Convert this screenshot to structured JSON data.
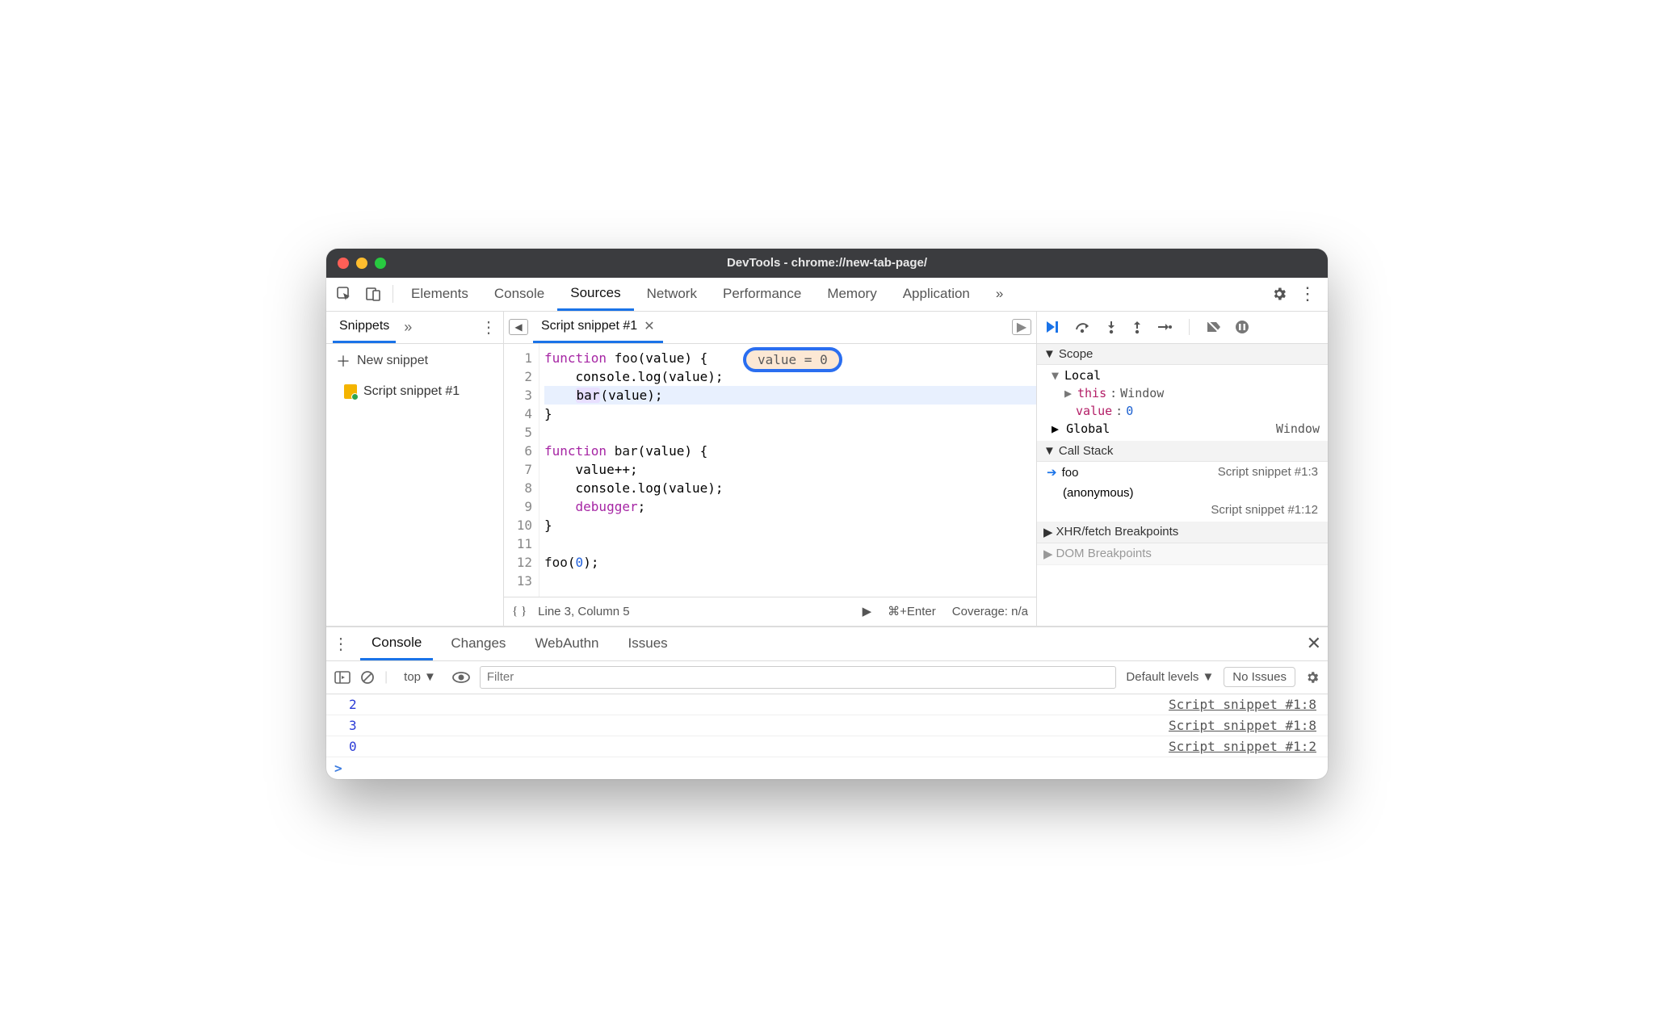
{
  "window": {
    "title": "DevTools - chrome://new-tab-page/"
  },
  "tabs": {
    "items": [
      "Elements",
      "Console",
      "Sources",
      "Network",
      "Performance",
      "Memory",
      "Application"
    ],
    "active": "Sources"
  },
  "sidebar": {
    "tab_label": "Snippets",
    "new_label": "New snippet",
    "items": [
      {
        "label": "Script snippet #1"
      }
    ]
  },
  "editor": {
    "file_tab": "Script snippet #1",
    "hint_text": "value = 0",
    "lines": [
      {
        "n": 1
      },
      {
        "n": 2
      },
      {
        "n": 3,
        "highlight": true
      },
      {
        "n": 4
      },
      {
        "n": 5
      },
      {
        "n": 6
      },
      {
        "n": 7
      },
      {
        "n": 8
      },
      {
        "n": 9
      },
      {
        "n": 10
      },
      {
        "n": 11
      },
      {
        "n": 12
      },
      {
        "n": 13
      }
    ],
    "code": {
      "l1_kw": "function",
      "l1_fn": "foo",
      "l1_rest": "(value) {",
      "l2": "    console.log(value);",
      "l3_pre": "    ",
      "l3_fn": "bar",
      "l3_rest": "(value);",
      "l4": "}",
      "l5": "",
      "l6_kw": "function",
      "l6_fn": "bar",
      "l6_rest": "(value) {",
      "l7": "    value++;",
      "l8": "    console.log(value);",
      "l9_pre": "    ",
      "l9_kw": "debugger",
      "l9_rest": ";",
      "l10": "}",
      "l11": "",
      "l12_fn": "foo",
      "l12_num": "0",
      "l12_open": "(",
      "l12_close": ");",
      "l13": ""
    },
    "status": {
      "cursor": "Line 3, Column 5",
      "run_hint": "⌘+Enter",
      "coverage": "Coverage: n/a"
    }
  },
  "debugger": {
    "scope_label": "Scope",
    "local_label": "Local",
    "this_key": "this",
    "this_val": "Window",
    "value_key": "value",
    "value_val": "0",
    "global_label": "Global",
    "global_val": "Window",
    "callstack_label": "Call Stack",
    "frames": [
      {
        "name": "foo",
        "location": "Script snippet #1:3",
        "active": true
      },
      {
        "name": "(anonymous)",
        "location": "Script snippet #1:12"
      }
    ],
    "xhr_label": "XHR/fetch Breakpoints",
    "dom_label": "DOM Breakpoints"
  },
  "drawer": {
    "tabs": [
      "Console",
      "Changes",
      "WebAuthn",
      "Issues"
    ],
    "active": "Console",
    "toolbar": {
      "context": "top",
      "filter_placeholder": "Filter",
      "levels": "Default levels",
      "no_issues": "No Issues"
    },
    "rows": [
      {
        "value": "2",
        "source": "Script snippet #1:8"
      },
      {
        "value": "3",
        "source": "Script snippet #1:8"
      },
      {
        "value": "0",
        "source": "Script snippet #1:2"
      }
    ],
    "prompt": ">"
  }
}
